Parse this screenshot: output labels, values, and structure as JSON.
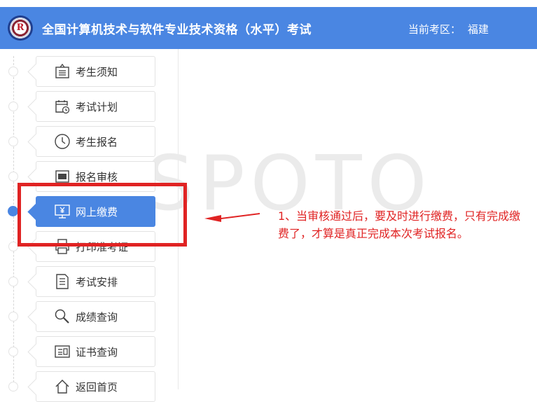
{
  "header": {
    "title": "全国计算机技术与软件专业技术资格（水平）考试",
    "region_label": "当前考区：",
    "region_value": "福建",
    "logo_icon": "seal-logo-icon",
    "color": "#4a86e2"
  },
  "sidebar": {
    "items": [
      {
        "label": "考生须知",
        "icon": "notice-board-icon",
        "active": false
      },
      {
        "label": "考试计划",
        "icon": "calendar-clock-icon",
        "active": false
      },
      {
        "label": "考生报名",
        "icon": "clock-icon",
        "active": false
      },
      {
        "label": "报名审核",
        "icon": "review-doc-icon",
        "active": false
      },
      {
        "label": "网上缴费",
        "icon": "monitor-yen-icon",
        "active": true
      },
      {
        "label": "打印准考证",
        "icon": "printer-icon",
        "active": false
      },
      {
        "label": "考试安排",
        "icon": "document-list-icon",
        "active": false
      },
      {
        "label": "成绩查询",
        "icon": "magnifier-icon",
        "active": false
      },
      {
        "label": "证书查询",
        "icon": "certificate-icon",
        "active": false
      },
      {
        "label": "返回首页",
        "icon": "home-icon",
        "active": false
      }
    ]
  },
  "watermark": "SPOTO",
  "annotation": {
    "text": "1、当审核通过后，要及时进行缴费，只有完成缴费了，才算是真正完成本次考试报名。",
    "color": "#e02323"
  }
}
